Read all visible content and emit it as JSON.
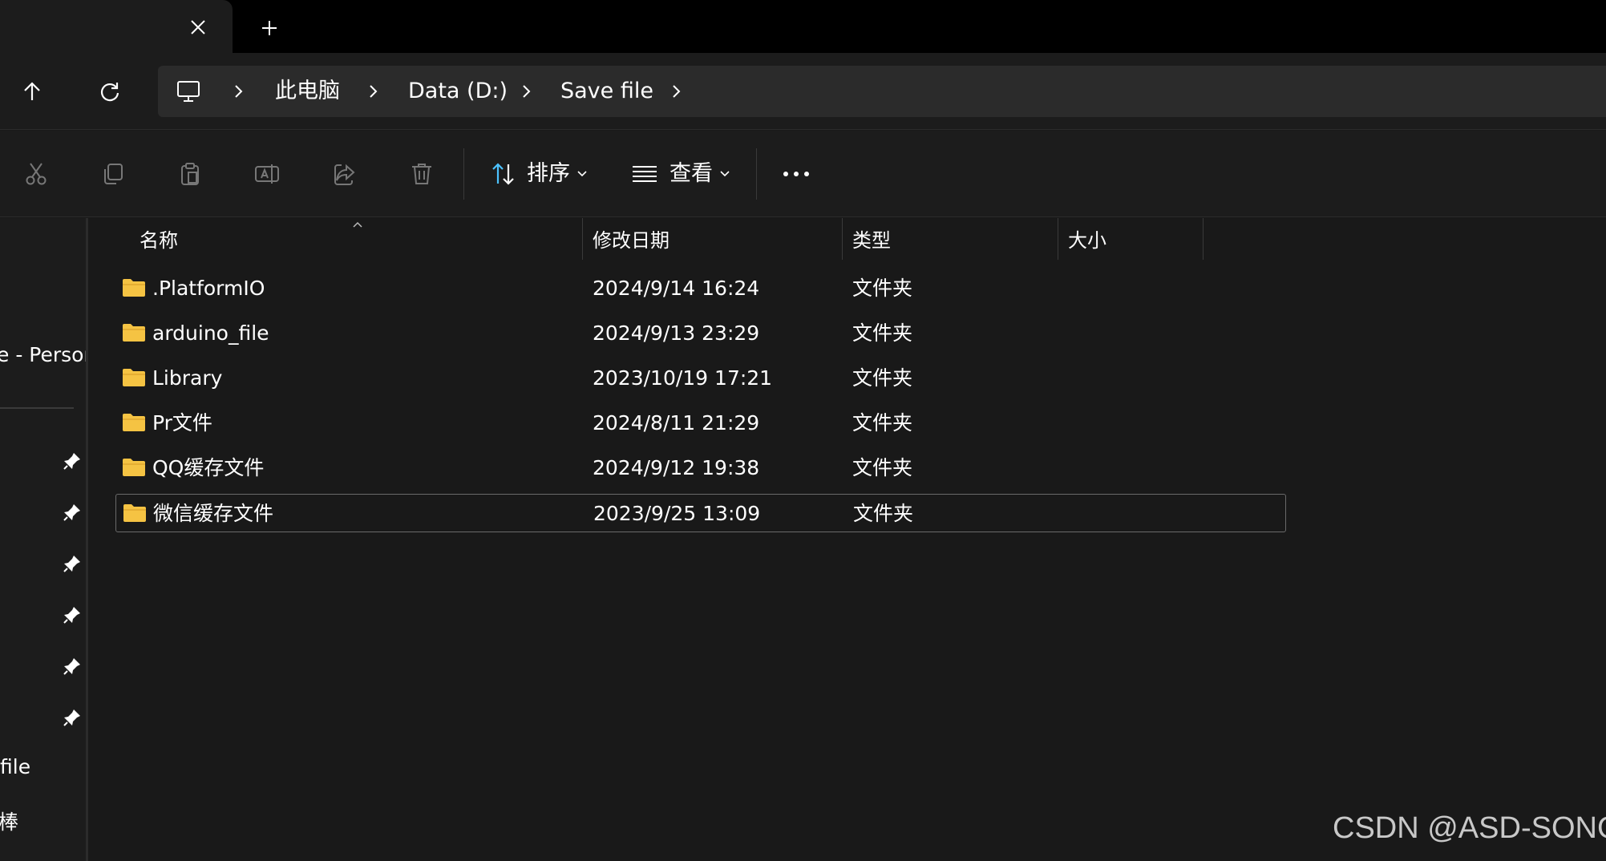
{
  "tab": {
    "close_icon": "close-icon",
    "new_tab_icon": "plus-icon"
  },
  "nav": {
    "up_icon": "arrow-up-icon",
    "refresh_icon": "refresh-icon"
  },
  "breadcrumb": {
    "root_icon": "computer-icon",
    "items": [
      "此电脑",
      "Data (D:)",
      "Save file"
    ]
  },
  "commandbar": {
    "sort_label": "排序",
    "view_label": "查看",
    "icons": [
      "cut-icon",
      "copy-icon",
      "paste-icon",
      "rename-icon",
      "share-icon",
      "delete-icon",
      "sort-icon",
      "view-list-icon",
      "more-icon"
    ]
  },
  "sidebar": {
    "onedrive_label": "e - Persor",
    "item_file": "file",
    "item_bang": "棒"
  },
  "columns": {
    "name": "名称",
    "date": "修改日期",
    "type": "类型",
    "size": "大小"
  },
  "files": [
    {
      "name": ".PlatformIO",
      "date": "2024/9/14 16:24",
      "type": "文件夹"
    },
    {
      "name": "arduino_file",
      "date": "2024/9/13 23:29",
      "type": "文件夹"
    },
    {
      "name": "Library",
      "date": "2023/10/19 17:21",
      "type": "文件夹"
    },
    {
      "name": "Pr文件",
      "date": "2024/8/11 21:29",
      "type": "文件夹"
    },
    {
      "name": "QQ缓存文件",
      "date": "2024/9/12 19:38",
      "type": "文件夹"
    },
    {
      "name": "微信缓存文件",
      "date": "2023/9/25 13:09",
      "type": "文件夹"
    }
  ],
  "watermark": "CSDN @ASD-SONG",
  "colors": {
    "accent": "#4cc2ff",
    "folder": "#f5c343",
    "background": "#191919"
  }
}
